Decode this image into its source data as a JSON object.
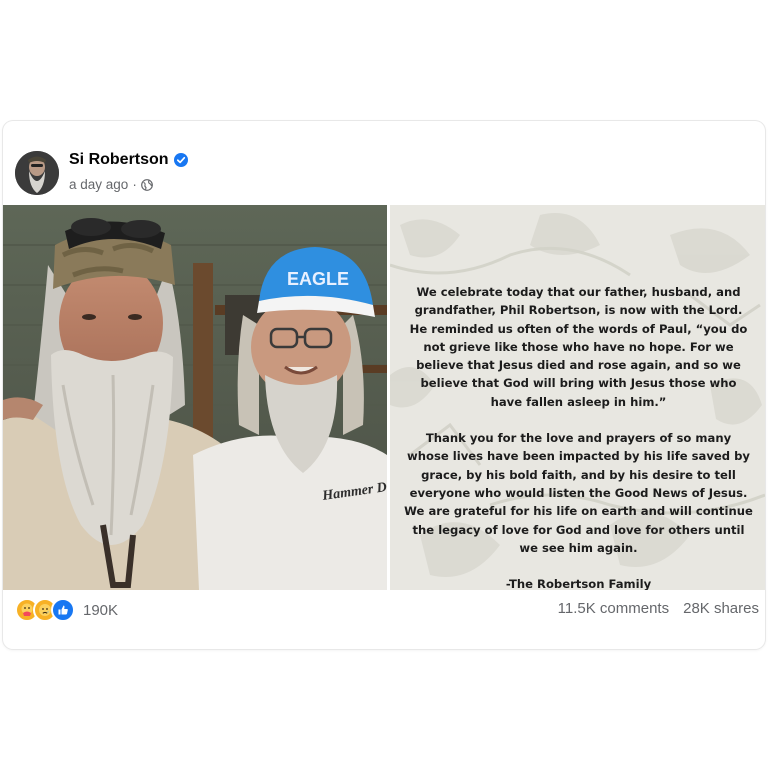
{
  "post": {
    "author": "Si Robertson",
    "verified": true,
    "timestamp": "a day ago",
    "visibility_icon": "globe-icon"
  },
  "photo": {
    "cap_text": "EAGLE",
    "shirt_text": "Hammer Down"
  },
  "statement": {
    "paragraph1": "We celebrate today that our father, husband, and grandfather, Phil Robertson, is now with the Lord. He reminded us often of the words of Paul, “you do not grieve like those who have no hope. For we believe that Jesus died and rose again, and so we believe that God will bring with Jesus those who have fallen asleep in him.”",
    "paragraph2": "Thank you for the love and prayers of so many whose lives have been impacted by his life saved by grace, by his bold faith, and by his desire to tell everyone who would listen the Good News of Jesus. We are grateful for his life on earth and will continue the legacy of love for God and love for others until we see him again.",
    "signature": "-The Robertson Family"
  },
  "footer": {
    "reactions": [
      "care-reaction-icon",
      "sad-reaction-icon",
      "like-reaction-icon"
    ],
    "reaction_count": "190K",
    "comments": "11.5K comments",
    "shares": "28K shares"
  },
  "colors": {
    "facebook_blue": "#1877f2",
    "secondary_text": "#65676b",
    "cap_blue": "#2f8fe0"
  }
}
